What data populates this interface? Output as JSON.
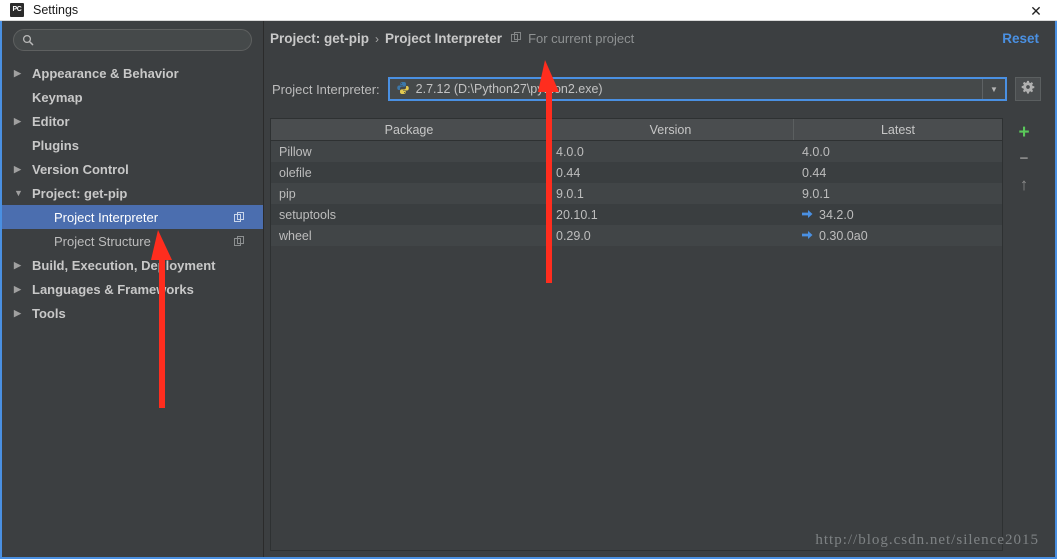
{
  "window": {
    "app_icon": "PC",
    "title": "Settings",
    "close_label": "✕"
  },
  "sidebar": {
    "search": {
      "value": "",
      "placeholder": "",
      "icon": "search-icon"
    },
    "items": [
      {
        "label": "Appearance & Behavior",
        "level": 0,
        "twisty": "▶",
        "selected": false,
        "copy_icon": false
      },
      {
        "label": "Keymap",
        "level": 0,
        "twisty": "",
        "selected": false,
        "copy_icon": false
      },
      {
        "label": "Editor",
        "level": 0,
        "twisty": "▶",
        "selected": false,
        "copy_icon": false
      },
      {
        "label": "Plugins",
        "level": 0,
        "twisty": "",
        "selected": false,
        "copy_icon": false
      },
      {
        "label": "Version Control",
        "level": 0,
        "twisty": "▶",
        "selected": false,
        "copy_icon": false
      },
      {
        "label": "Project: get-pip",
        "level": 0,
        "twisty": "▼",
        "selected": false,
        "copy_icon": false
      },
      {
        "label": "Project Interpreter",
        "level": 1,
        "twisty": "",
        "selected": true,
        "copy_icon": true
      },
      {
        "label": "Project Structure",
        "level": 1,
        "twisty": "",
        "selected": false,
        "copy_icon": true
      },
      {
        "label": "Build, Execution, Deployment",
        "level": 0,
        "twisty": "▶",
        "selected": false,
        "copy_icon": false
      },
      {
        "label": "Languages & Frameworks",
        "level": 0,
        "twisty": "▶",
        "selected": false,
        "copy_icon": false
      },
      {
        "label": "Tools",
        "level": 0,
        "twisty": "▶",
        "selected": false,
        "copy_icon": false
      }
    ]
  },
  "header": {
    "crumb1": "Project: get-pip",
    "separator": "›",
    "crumb2": "Project Interpreter",
    "scope_icon": "copy-scope-icon",
    "scope_note": "For current project",
    "reset_label": "Reset"
  },
  "interpreter": {
    "label": "Project Interpreter:",
    "icon": "python-icon",
    "value": "2.7.12 (D:\\Python27\\python2.exe)",
    "dropdown_icon": "chevron-down-icon",
    "settings_icon": "gear-icon"
  },
  "packages": {
    "columns": [
      "Package",
      "Version",
      "Latest"
    ],
    "rows": [
      {
        "package": "Pillow",
        "version": "4.0.0",
        "latest": "4.0.0",
        "upgradable": false
      },
      {
        "package": "olefile",
        "version": "0.44",
        "latest": "0.44",
        "upgradable": false
      },
      {
        "package": "pip",
        "version": "9.0.1",
        "latest": "9.0.1",
        "upgradable": false
      },
      {
        "package": "setuptools",
        "version": "20.10.1",
        "latest": "34.2.0",
        "upgradable": true
      },
      {
        "package": "wheel",
        "version": "0.29.0",
        "latest": "0.30.0a0",
        "upgradable": true
      }
    ],
    "buttons": [
      {
        "name": "add-package-button",
        "glyph": "+",
        "color": "#5ac85a"
      },
      {
        "name": "remove-package-button",
        "glyph": "−",
        "color": "#8d8d8d"
      },
      {
        "name": "upgrade-package-button",
        "glyph": "↑",
        "color": "#8d8d8d"
      }
    ]
  },
  "watermark": {
    "text": "http://blog.csdn.net/silence2015"
  },
  "colors": {
    "background": "#3c3f41",
    "selection": "#4b6eaf",
    "accent": "#4a90e2",
    "link": "#4a90e2",
    "annotation": "#ff2d1e",
    "add_button": "#5ac85a"
  }
}
